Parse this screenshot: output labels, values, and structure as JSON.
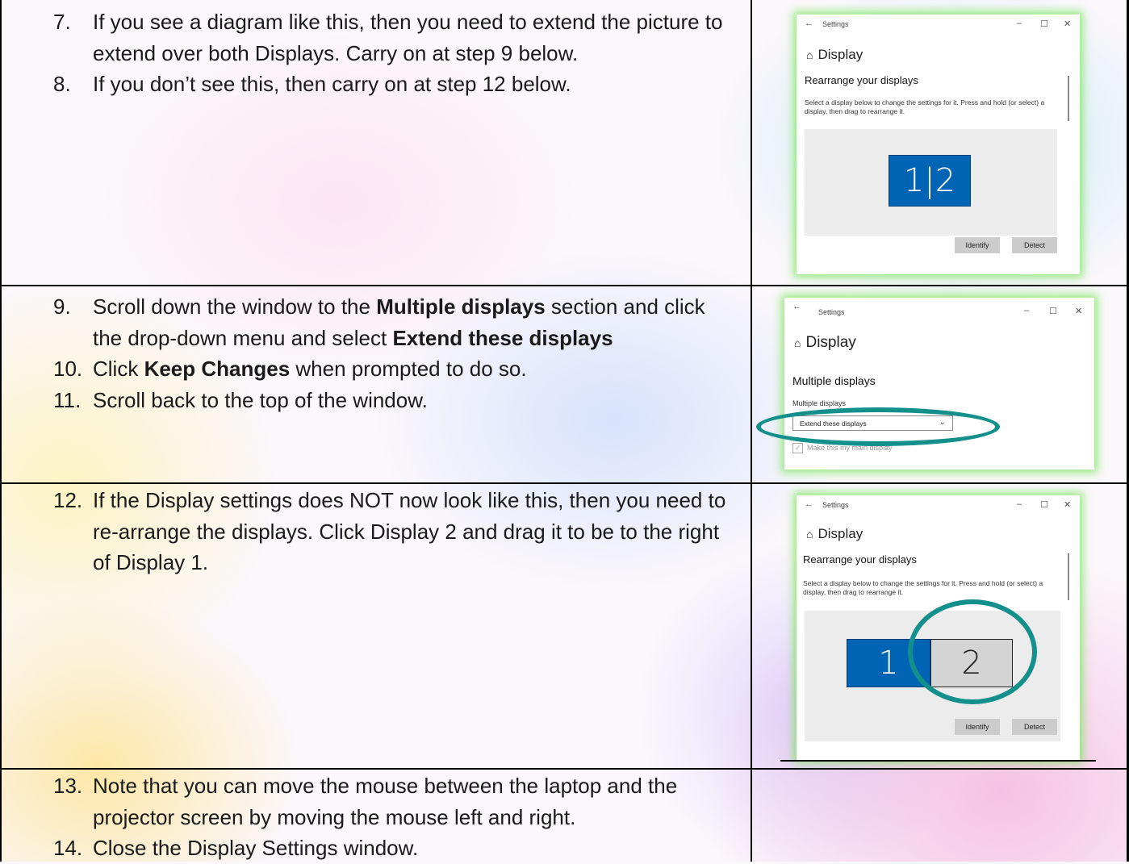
{
  "rows": [
    {
      "steps": [
        {
          "num": "7.",
          "parts": [
            {
              "t": "If you see a diagram like this, then you need to extend the picture to extend over both Displays.  Carry on at step 9 below.",
              "b": false
            }
          ]
        },
        {
          "num": "8.",
          "parts": [
            {
              "t": "If you don’t see this, then carry on at step 12 below.",
              "b": false
            }
          ]
        }
      ]
    },
    {
      "steps": [
        {
          "num": "9.",
          "parts": [
            {
              "t": "Scroll down the window to the ",
              "b": false
            },
            {
              "t": "Multiple displays",
              "b": true
            },
            {
              "t": " section and click the drop-down menu and select ",
              "b": false
            },
            {
              "t": "Extend these displays",
              "b": true
            }
          ]
        },
        {
          "num": "10.",
          "parts": [
            {
              "t": "Click ",
              "b": false
            },
            {
              "t": "Keep Changes",
              "b": true
            },
            {
              "t": " when prompted to do so.",
              "b": false
            }
          ]
        },
        {
          "num": "11.",
          "parts": [
            {
              "t": "Scroll back to the top of the window.",
              "b": false
            }
          ]
        }
      ]
    },
    {
      "steps": [
        {
          "num": "12.",
          "parts": [
            {
              "t": "If the Display settings does NOT now look like this, then you need to re-arrange the displays.  Click Display 2 and drag it to be to the right of Display 1.",
              "b": false
            }
          ]
        }
      ]
    },
    {
      "steps": [
        {
          "num": "13.",
          "parts": [
            {
              "t": "Note that you can move the mouse between the laptop and the projector screen by moving the mouse left and right.",
              "b": false
            }
          ]
        },
        {
          "num": "14.",
          "parts": [
            {
              "t": "Close the Display Settings window.",
              "b": false
            }
          ]
        }
      ]
    }
  ],
  "shot1": {
    "back": "←",
    "title": "Settings",
    "min": "–",
    "max": "☐",
    "close": "✕",
    "home_icon": "⌂",
    "header": "Display",
    "subheader": "Rearrange your displays",
    "desc": "Select a display below to change the settings for it. Press and hold (or select) a display, then drag to rearrange it.",
    "monitor": "1|2",
    "identify": "Identify",
    "detect": "Detect"
  },
  "shot2": {
    "back": "←",
    "title": "Settings",
    "min": "–",
    "max": "☐",
    "close": "✕",
    "home_icon": "⌂",
    "header": "Display",
    "subheader": "Multiple displays",
    "dropdown_label": "Multiple displays",
    "dropdown_value": "Extend these displays",
    "chevron": "⌄",
    "checkbox_mark": "✓",
    "checkbox_label": "Make this my main display",
    "accent": "#14908c"
  },
  "shot3": {
    "back": "←",
    "title": "Settings",
    "min": "–",
    "max": "☐",
    "close": "✕",
    "home_icon": "⌂",
    "header": "Display",
    "subheader": "Rearrange your displays",
    "desc": "Select a display below to change the settings for it. Press and hold (or select) a display, then drag to rearrange it.",
    "monitor1": "1",
    "monitor2": "2",
    "identify": "Identify",
    "detect": "Detect",
    "accent": "#14908c"
  }
}
